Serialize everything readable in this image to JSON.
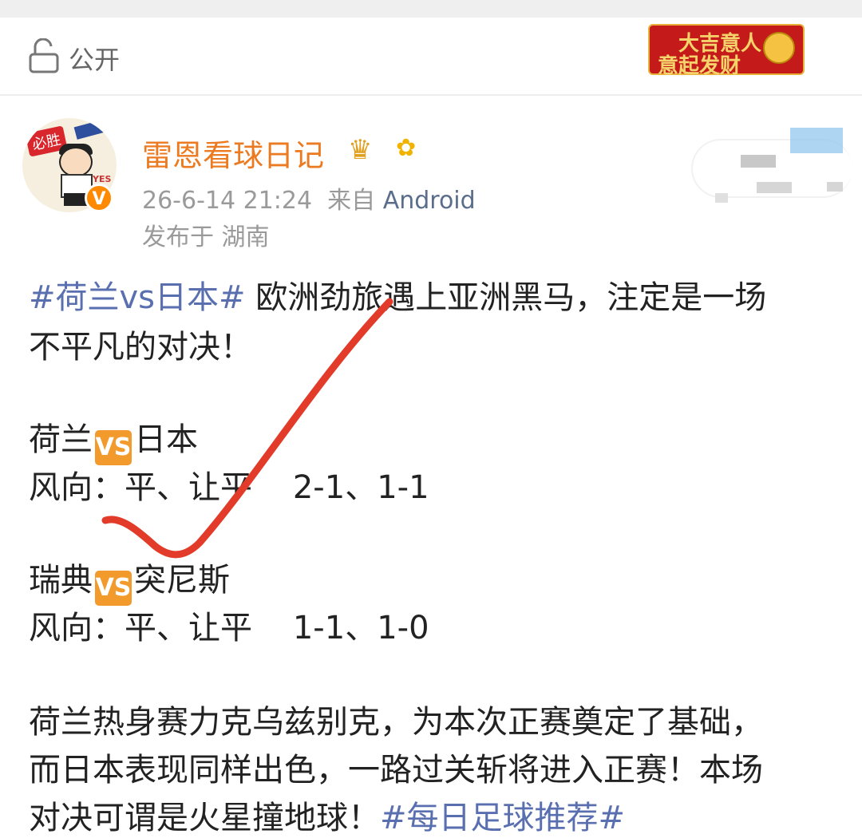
{
  "visibility": {
    "label": "公开",
    "icon": "lock-open-icon"
  },
  "badge": {
    "line1": "大吉意人",
    "line2": "意起发财",
    "icon": "coin-icon"
  },
  "author": {
    "name": "雷恩看球日记",
    "avatar_tag": "必胜",
    "avatar_note": "YES",
    "verified_mark": "V",
    "crown_icon": "crown-icon",
    "flower_icon": "sunflower-icon"
  },
  "meta": {
    "time": "26-6-14 21:24",
    "from_label": "来自",
    "source": "Android",
    "location": "发布于 湖南"
  },
  "post": {
    "topic": "#荷兰vs日本#",
    "intro_a": " 欧洲劲旅遇上亚洲黑马，注定是一场",
    "intro_b": "不平凡的对决！",
    "vs_label": "VS",
    "m1_home": "荷兰",
    "m1_away": "日本",
    "m1_tip": "风向：平、让平    2-1、1-1",
    "m2_home": "瑞典",
    "m2_away": "突尼斯",
    "m2_tip": "风向：平、让平    1-1、1-0",
    "para_a": "荷兰热身赛力克乌兹别克，为本次正赛奠定了基础，",
    "para_b": "而日本表现同样出色，一路过关斩将进入正赛！本场",
    "para_c": "对决可谓是火星撞地球！",
    "topic2": "#每日足球推荐#"
  },
  "annotation": {
    "type": "red-checkmark",
    "color": "#e33b2a"
  }
}
